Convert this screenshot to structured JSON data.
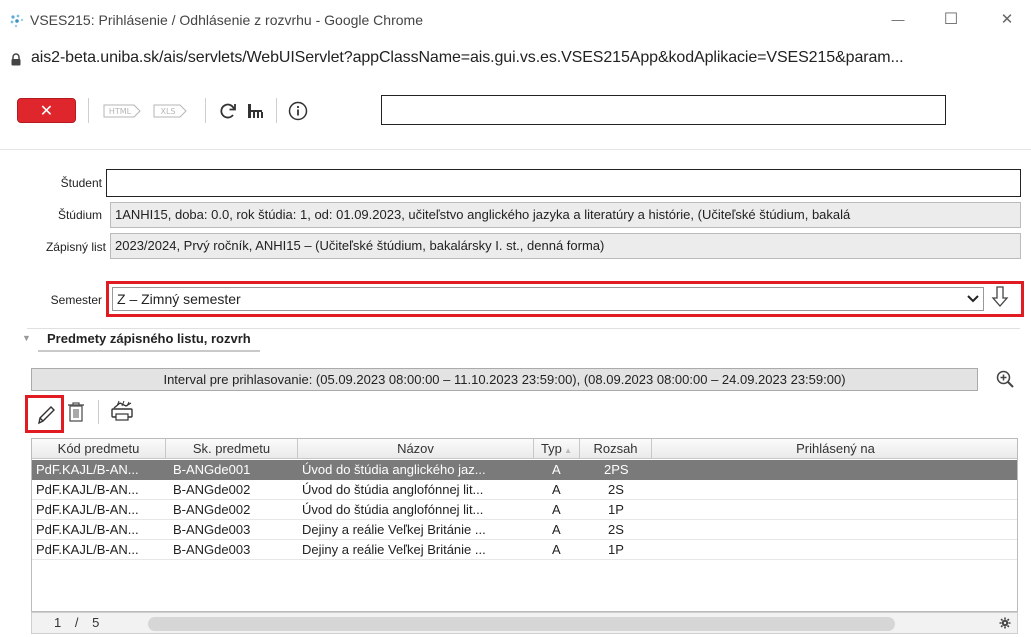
{
  "window": {
    "title": "VSES215: Prihlásenie / Odhlásenie z rozvrhu - Google Chrome",
    "minimize_glyph": "—",
    "maximize_glyph": "☐",
    "close_glyph": "✕"
  },
  "address": {
    "url": "ais2-beta.uniba.sk/ais/servlets/WebUIServlet?appClassName=ais.gui.vs.es.VSES215App&kodAplikacie=VSES215&param..."
  },
  "toolbar": {
    "close_label": "✕",
    "html_label": "HTML",
    "xls_label": "XLS",
    "search_value": ""
  },
  "form": {
    "student_label": "Študent",
    "student_value": "",
    "study_label": "Štúdium",
    "study_value": "1ANHI15, doba: 0.0, rok štúdia: 1, od: 01.09.2023, učiteľstvo anglického jazyka a literatúry a histórie, (Učiteľské štúdium, bakalá",
    "enrollment_label": "Zápisný list",
    "enrollment_value": "2023/2024, Prvý ročník, ANHI15 – (Učiteľské štúdium, bakalársky I. st., denná forma)",
    "semester_label": "Semester",
    "semester_value": "Z – Zimný semester"
  },
  "section": {
    "title": "Predmety zápisného listu, rozvrh",
    "interval": "Interval pre prihlasovanie: (05.09.2023 08:00:00 – 11.10.2023 23:59:00), (08.09.2023 08:00:00 – 24.09.2023 23:59:00)"
  },
  "table": {
    "headers": [
      "Kód predmetu",
      "Sk. predmetu",
      "Názov",
      "Typ",
      "Rozsah",
      "Prihlásený na"
    ],
    "rows": [
      {
        "kod": "PdF.KAJL/B-AN...",
        "sk": "B-ANGde001",
        "nazov": "Úvod do štúdia anglického jaz...",
        "typ": "A",
        "rozsah": "2PS",
        "prihlaseny": ""
      },
      {
        "kod": "PdF.KAJL/B-AN...",
        "sk": "B-ANGde002",
        "nazov": "Úvod do štúdia anglofónnej lit...",
        "typ": "A",
        "rozsah": "2S",
        "prihlaseny": ""
      },
      {
        "kod": "PdF.KAJL/B-AN...",
        "sk": "B-ANGde002",
        "nazov": "Úvod do štúdia anglofónnej lit...",
        "typ": "A",
        "rozsah": "1P",
        "prihlaseny": ""
      },
      {
        "kod": "PdF.KAJL/B-AN...",
        "sk": "B-ANGde003",
        "nazov": "Dejiny a reálie Veľkej Británie ...",
        "typ": "A",
        "rozsah": "2S",
        "prihlaseny": ""
      },
      {
        "kod": "PdF.KAJL/B-AN...",
        "sk": "B-ANGde003",
        "nazov": "Dejiny a reálie Veľkej Británie ...",
        "typ": "A",
        "rozsah": "1P",
        "prihlaseny": ""
      }
    ],
    "selected_row": 0
  },
  "pager": {
    "current": "1",
    "separator": "/",
    "total": "5"
  },
  "colors": {
    "accent_red": "#e01b22",
    "close_button": "#e0262d",
    "selected_row": "#7a7a7a"
  }
}
